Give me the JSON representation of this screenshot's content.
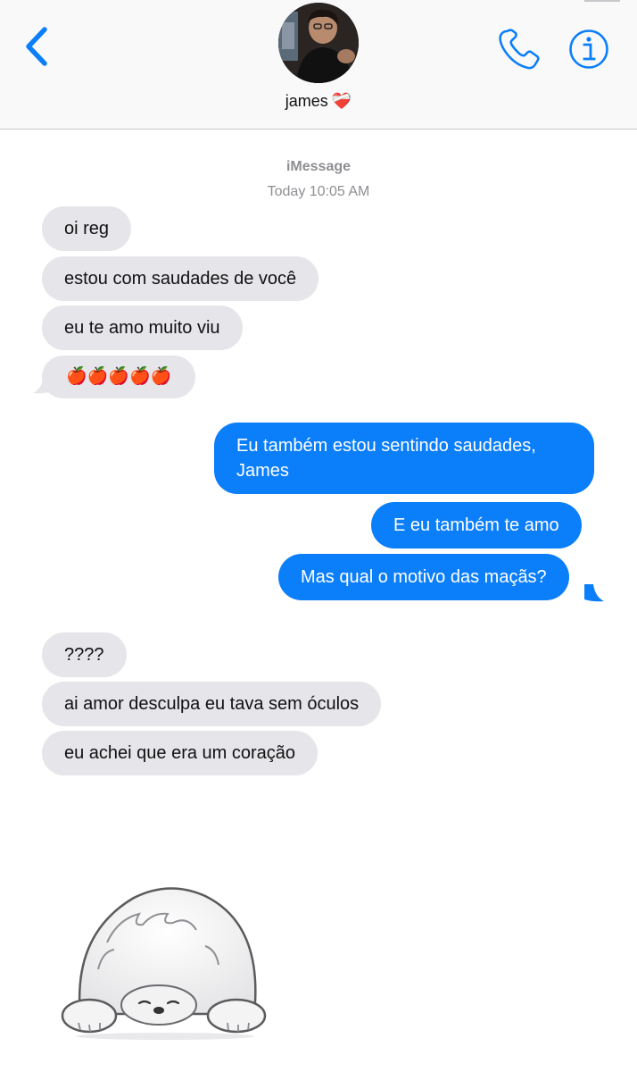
{
  "header": {
    "contact_name": "james",
    "contact_emoji": "❤️‍🩹"
  },
  "thread": {
    "service": "iMessage",
    "timestamp": "Today 10:05 AM"
  },
  "messages": [
    {
      "dir": "in",
      "text": "oi reg"
    },
    {
      "dir": "in",
      "text": "estou com saudades de você"
    },
    {
      "dir": "in",
      "text": "eu te amo muito viu"
    },
    {
      "dir": "in",
      "text": "🍎🍎🍎🍎🍎"
    },
    {
      "dir": "out",
      "text": "Eu também estou sentindo saudades, James"
    },
    {
      "dir": "out",
      "text": "E eu também te amo"
    },
    {
      "dir": "out",
      "text": "Mas qual o motivo das maçãs?"
    },
    {
      "dir": "in",
      "text": "????"
    },
    {
      "dir": "in",
      "text": "ai amor desculpa eu tava sem óculos"
    },
    {
      "dir": "in",
      "text": "eu achei que era um coração"
    }
  ],
  "colors": {
    "accent": "#0b7efa",
    "incoming_bubble": "#e5e5ea",
    "meta_text": "#8e8e93"
  },
  "icons": {
    "back": "chevron-left-icon",
    "call": "phone-icon",
    "info": "info-icon",
    "sticker": "sad-bear-sticker"
  }
}
